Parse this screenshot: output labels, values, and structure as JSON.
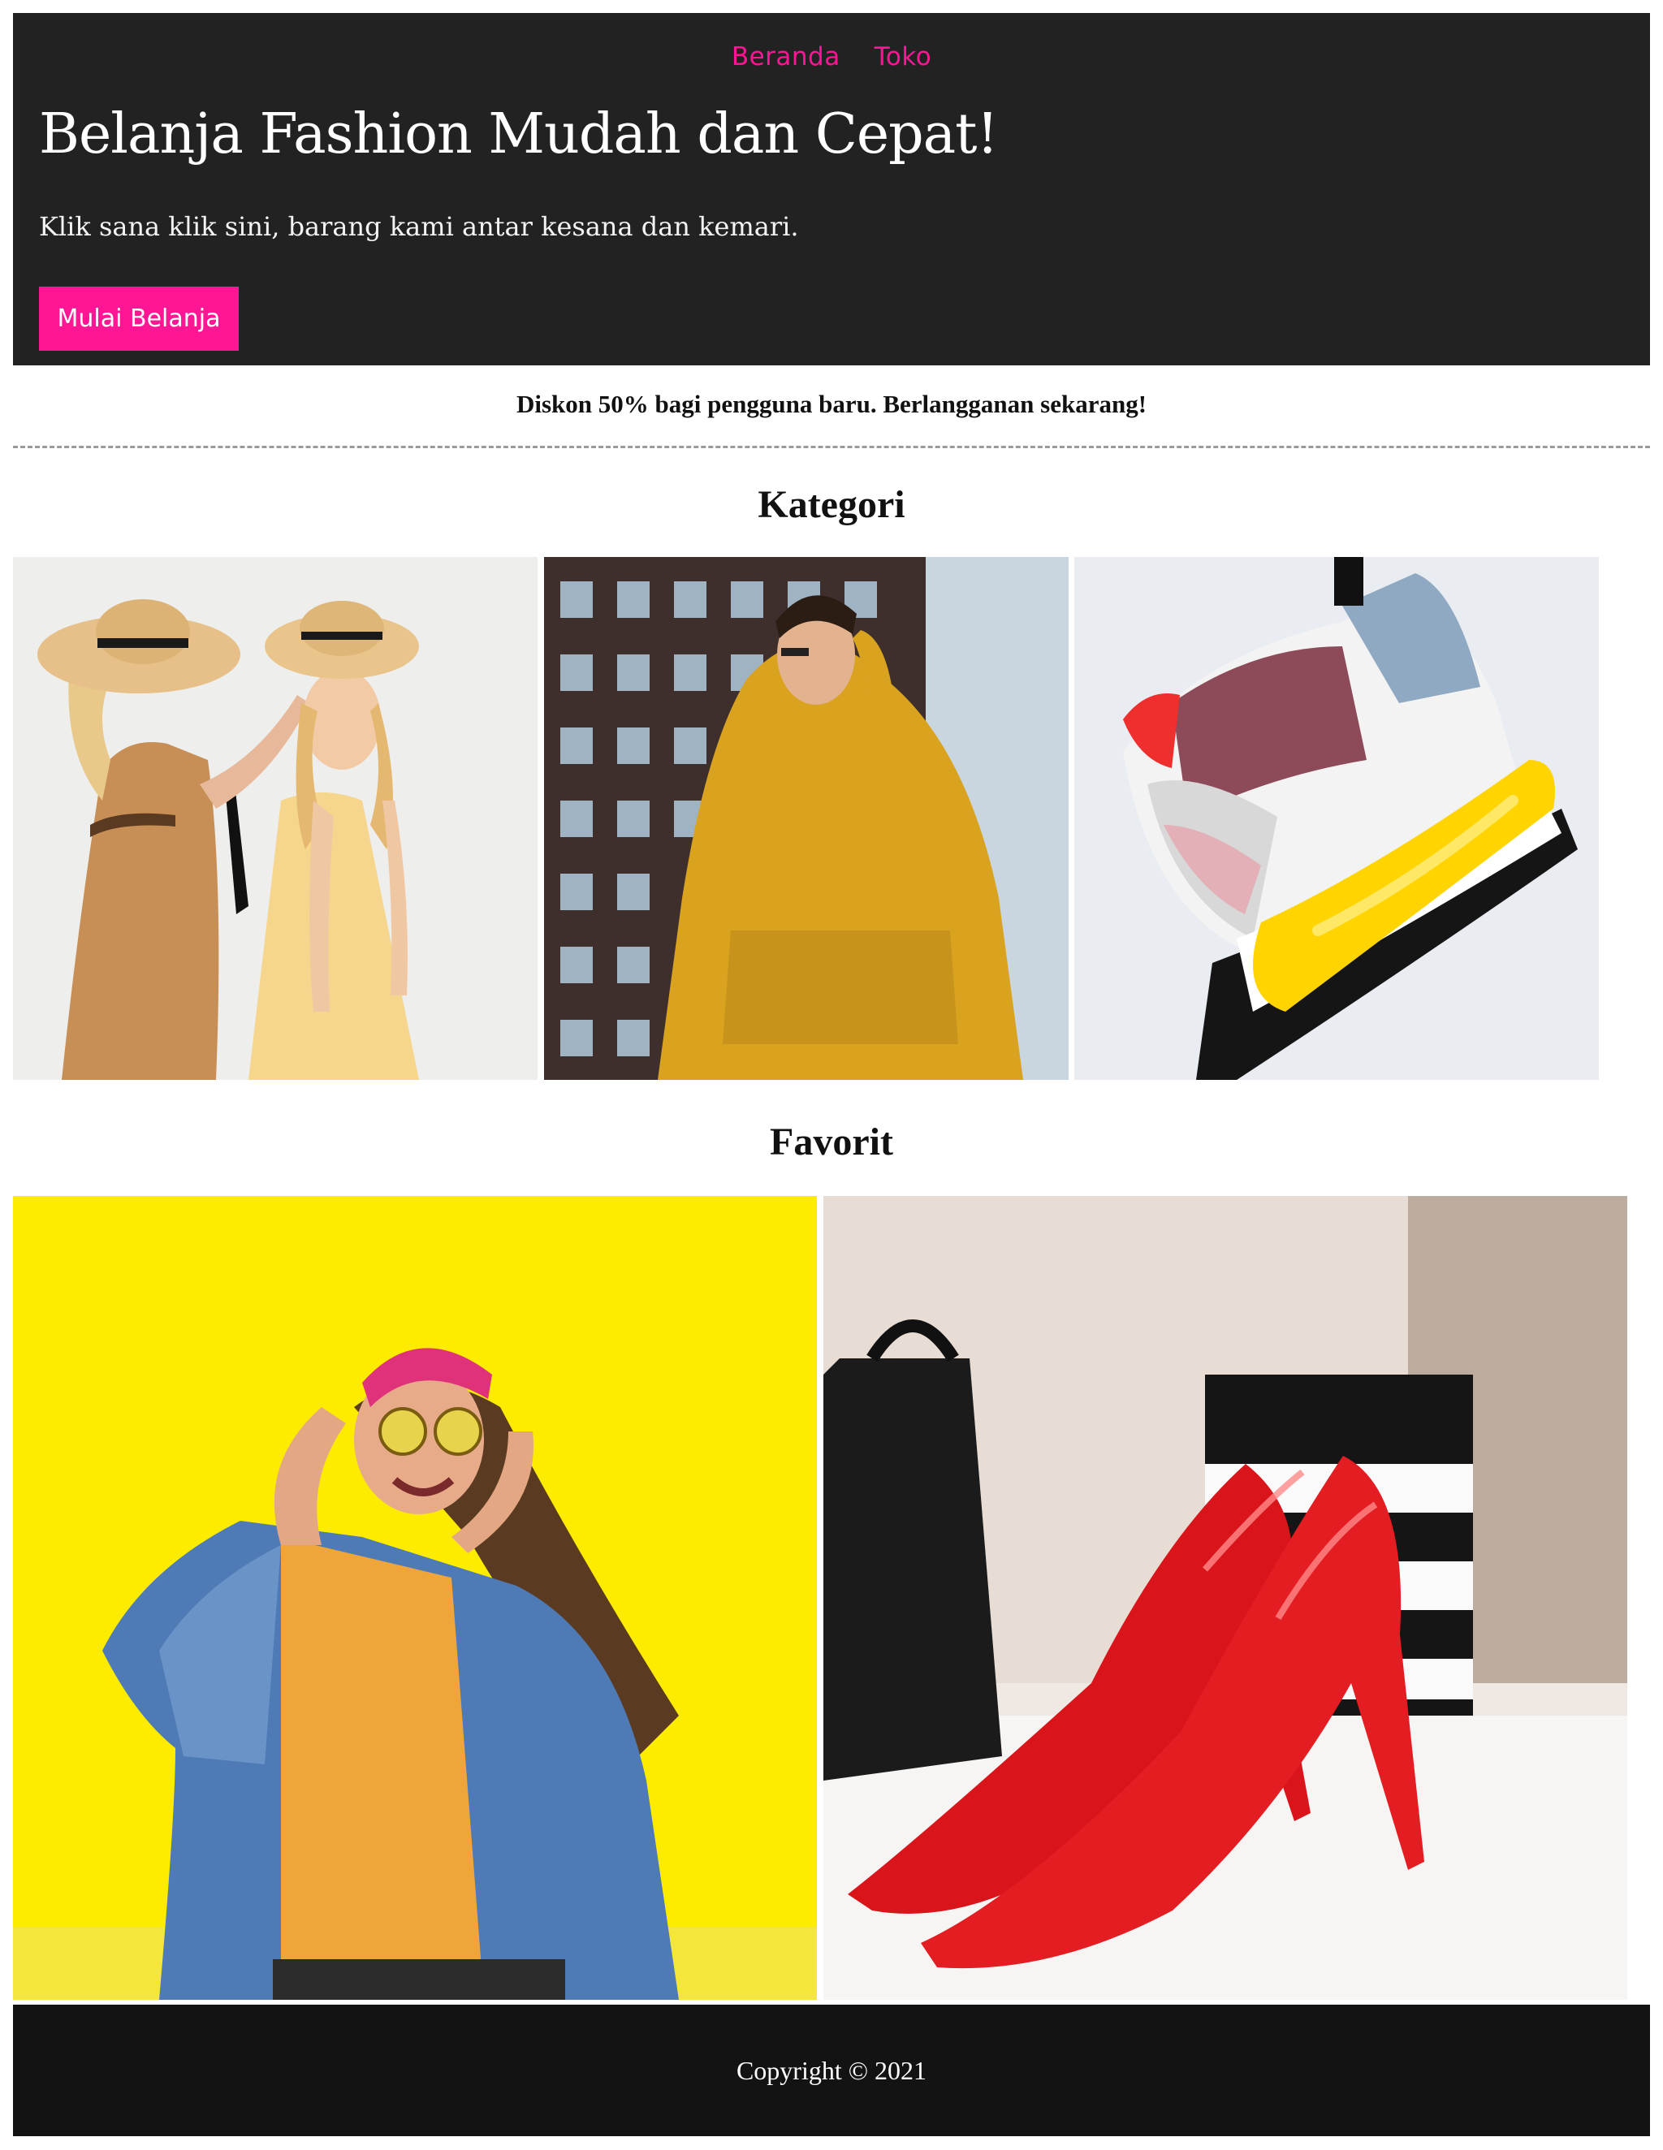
{
  "nav": {
    "items": [
      "Beranda",
      "Toko"
    ]
  },
  "hero": {
    "title": "Belanja Fashion Mudah dan Cepat!",
    "subtitle": "Klik sana klik sini, barang kami antar kesana dan kemari.",
    "cta_label": "Mulai Belanja"
  },
  "promo": {
    "text": "Diskon 50% bagi pengguna baru. Berlangganan sekarang!"
  },
  "sections": {
    "kategori_title": "Kategori",
    "favorit_title": "Favorit"
  },
  "footer": {
    "copyright": "Copyright © 2021"
  },
  "colors": {
    "accent": "#ff1694",
    "hero_bg": "#222223",
    "footer_bg": "#131313"
  }
}
